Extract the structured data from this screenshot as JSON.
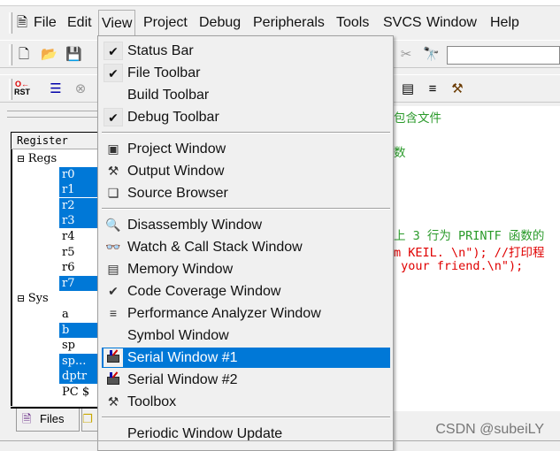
{
  "menubar": {
    "items": [
      {
        "label": "File",
        "accel": "F"
      },
      {
        "label": "Edit",
        "accel": "E"
      },
      {
        "label": "View",
        "accel": "V"
      },
      {
        "label": "Project",
        "accel": "P"
      },
      {
        "label": "Debug",
        "accel": "D"
      },
      {
        "label": "Peripherals",
        "accel": "r"
      },
      {
        "label": "Tools",
        "accel": "T"
      },
      {
        "label": "SVCS",
        "accel": "S"
      },
      {
        "label": "Window",
        "accel": "W"
      },
      {
        "label": "Help",
        "accel": "H"
      }
    ]
  },
  "view_menu": {
    "items": [
      {
        "label": "Status Bar",
        "accel": "S",
        "checked": true
      },
      {
        "label": "File Toolbar",
        "accel": "F",
        "checked": true
      },
      {
        "label": "Build Toolbar",
        "accel": "B",
        "checked": false
      },
      {
        "label": "Debug Toolbar",
        "accel": "g",
        "checked": true
      },
      {
        "label": "Project Window",
        "accel": "P",
        "icon": "project-window-icon"
      },
      {
        "label": "Output Window",
        "accel": "O",
        "icon": "output-window-icon"
      },
      {
        "label": "Source Browser",
        "accel": "e",
        "icon": "source-browser-icon"
      },
      {
        "label": "Disassembly Window",
        "accel": "D",
        "icon": "disassembly-icon"
      },
      {
        "label": "Watch & Call Stack Window",
        "accel": "W",
        "icon": "watch-icon"
      },
      {
        "label": "Memory Window",
        "accel": "M",
        "icon": "memory-icon"
      },
      {
        "label": "Code Coverage Window",
        "accel": "v",
        "icon": "code-coverage-icon"
      },
      {
        "label": "Performance Analyzer Window",
        "accel": "r",
        "icon": "performance-icon"
      },
      {
        "label": "Symbol Window",
        "accel": "l"
      },
      {
        "label": "Serial  Window #1",
        "accel": "1",
        "icon": "serial-1-icon",
        "highlighted": true
      },
      {
        "label": "Serial  Window #2",
        "accel": "2",
        "icon": "serial-2-icon"
      },
      {
        "label": "Toolbox",
        "accel": "T",
        "icon": "hammer-icon"
      },
      {
        "label": "Periodic Window Update",
        "accel": "U"
      }
    ]
  },
  "register": {
    "header": "Register",
    "groups": [
      {
        "name": "Regs",
        "items": [
          {
            "n": "r0",
            "sel": true
          },
          {
            "n": "r1",
            "sel": true
          },
          {
            "n": "r2",
            "sel": true
          },
          {
            "n": "r3",
            "sel": true
          },
          {
            "n": "r4"
          },
          {
            "n": "r5"
          },
          {
            "n": "r6"
          },
          {
            "n": "r7",
            "sel": true
          }
        ]
      },
      {
        "name": "Sys",
        "items": [
          {
            "n": "a"
          },
          {
            "n": "b",
            "sel": true
          },
          {
            "n": "sp"
          },
          {
            "n": "sp...",
            "sel": true
          },
          {
            "n": "dptr",
            "sel": true
          },
          {
            "n": "PC  $"
          }
        ]
      }
    ]
  },
  "tabs": {
    "files": "Files"
  },
  "code": {
    "lines": [
      {
        "text": "包含文件",
        "cls": "green"
      },
      {
        "text": "数",
        "cls": "green"
      },
      {
        "text": "上 3 行为 PRINTF 函数的",
        "cls": "green"
      },
      {
        "text": "m KEIL. \\n\"); //打印程",
        "cls": "red"
      },
      {
        "text": " your friend.\\n\");",
        "cls": "red"
      }
    ]
  },
  "watermark": "CSDN @subeiLY",
  "colors": {
    "highlight": "#0078d7",
    "comment": "#2a9a2a",
    "string": "#e00000"
  }
}
